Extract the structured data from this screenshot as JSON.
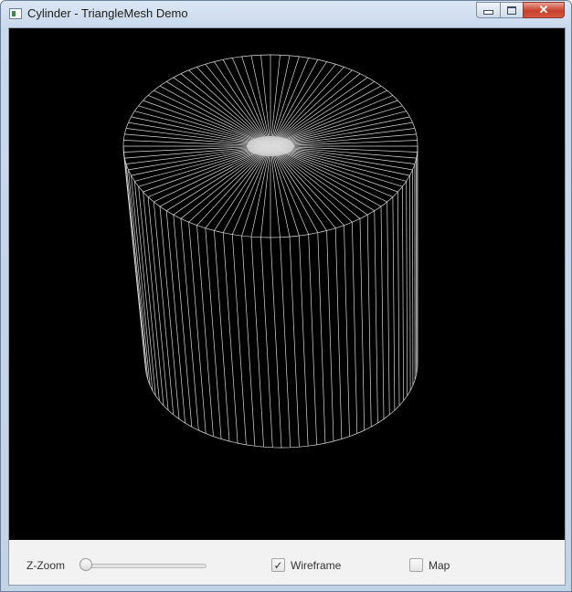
{
  "window": {
    "title": "Cylinder - TriangleMesh Demo",
    "icons": {
      "app": "app-window-icon",
      "minimize": "minimize-icon",
      "maximize": "maximize-icon",
      "close": "close-icon"
    }
  },
  "scene": {
    "background": "#000000",
    "wire_color": "#d9d9d9",
    "mesh": "cylinder",
    "render_mode": "wireframe"
  },
  "controls": {
    "zoom_label": "Z-Zoom",
    "zoom_value": 0.0,
    "wireframe_label": "Wireframe",
    "wireframe_checked": true,
    "map_label": "Map",
    "map_checked": false
  }
}
